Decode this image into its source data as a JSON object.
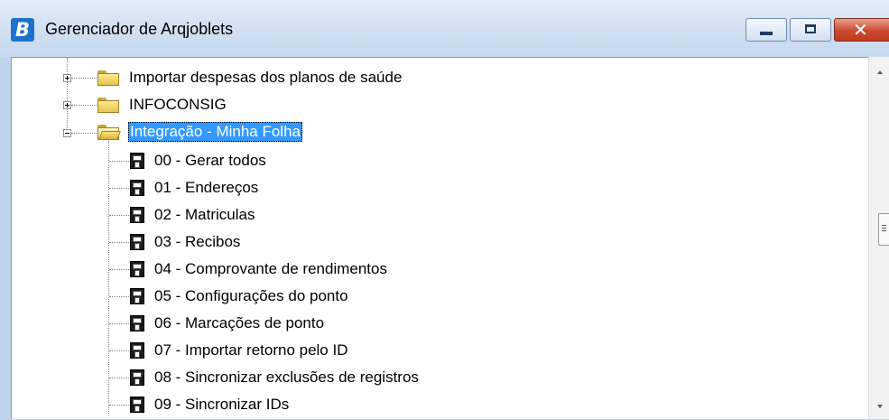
{
  "window": {
    "title": "Gerenciador de Arqjoblets",
    "app_icon_letter": "B",
    "buttons": {
      "minimize": "minimize",
      "maximize": "maximize",
      "close": "close"
    }
  },
  "tree": {
    "folders": [
      {
        "label": "Importar despesas dos planos de saúde",
        "expanded": false
      },
      {
        "label": "INFOCONSIG",
        "expanded": false
      },
      {
        "label": "Integração - Minha Folha",
        "expanded": true,
        "selected": true
      }
    ],
    "items": [
      "00 - Gerar todos",
      "01 - Endereços",
      "02 - Matriculas",
      "03 - Recibos",
      "04 - Comprovante de rendimentos",
      "05 - Configurações do ponto",
      "06 - Marcações de ponto",
      "07 - Importar retorno pelo ID",
      "08 - Sincronizar exclusões de registros",
      "09 - Sincronizar IDs"
    ]
  },
  "colors": {
    "selection": "#3399ff",
    "folder": "#f3d86b",
    "titlebar": "#d5e3f2"
  }
}
